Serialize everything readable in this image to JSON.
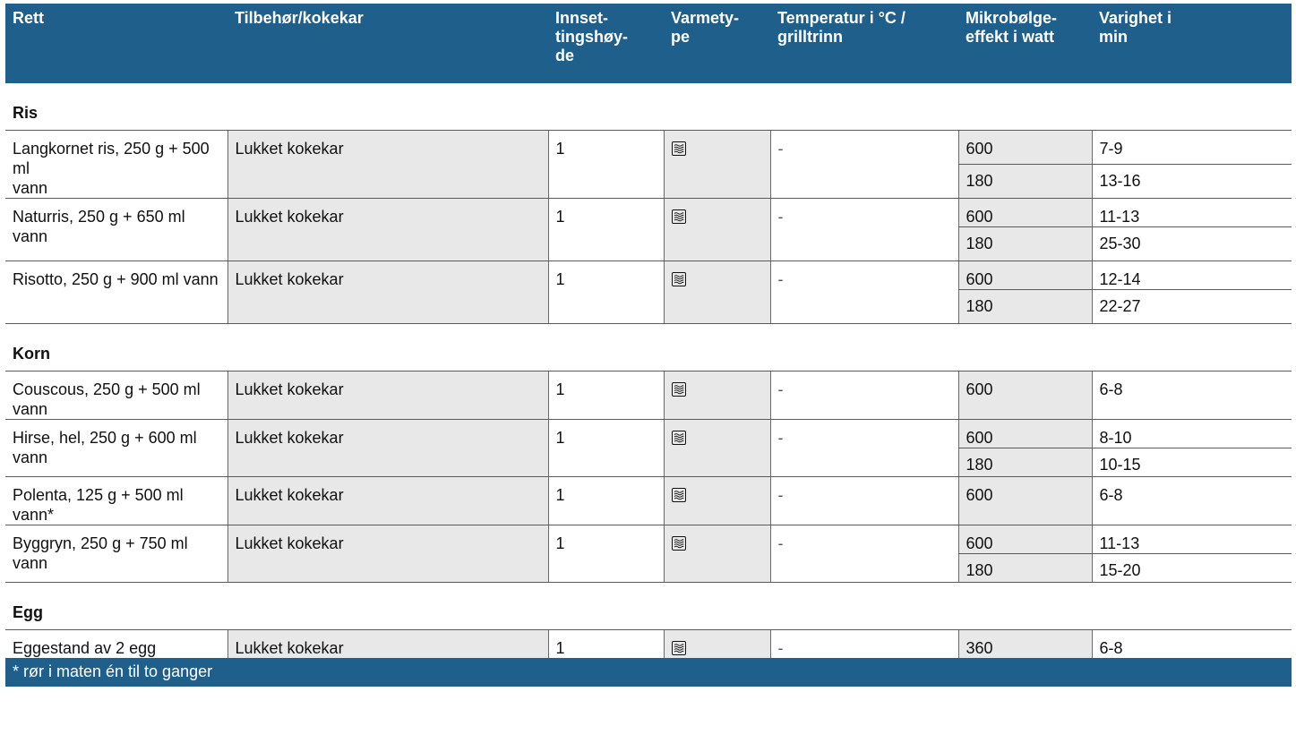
{
  "header": {
    "rett": "Rett",
    "tilbehor": "Tilbehør/kokekar",
    "innsetting_1": "Innset-",
    "innsetting_2": "tingshøy-",
    "innsetting_3": "de",
    "varmetype_1": "Varmety-",
    "varmetype_2": "pe",
    "temperatur_1": "Temperatur i °C /",
    "temperatur_2": "grilltrinn",
    "mikro_1": "Mikrobølge-",
    "mikro_2": "effekt i watt",
    "varighet_1": "Varighet i",
    "varighet_2": "min"
  },
  "groups": {
    "ris": "Ris",
    "korn": "Korn",
    "egg": "Egg"
  },
  "rows": {
    "langkornet": {
      "rett_1": "Langkornet ris, 250 g + 500 ml",
      "rett_2": "vann",
      "tilbehor": "Lukket kokekar",
      "hoyde": "1",
      "temp": "-",
      "effekt_1": "600",
      "tid_1": "7-9",
      "effekt_2": "180",
      "tid_2": "13-16"
    },
    "naturris": {
      "rett": "Naturris, 250 g + 650 ml vann",
      "tilbehor": "Lukket kokekar",
      "hoyde": "1",
      "temp": "-",
      "effekt_1": "600",
      "tid_1": "11-13",
      "effekt_2": "180",
      "tid_2": "25-30"
    },
    "risotto": {
      "rett": "Risotto, 250 g + 900 ml vann",
      "tilbehor": "Lukket kokekar",
      "hoyde": "1",
      "temp": "-",
      "effekt_1": "600",
      "tid_1": "12-14",
      "effekt_2": "180",
      "tid_2": "22-27"
    },
    "couscous": {
      "rett": "Couscous, 250 g + 500 ml vann",
      "tilbehor": "Lukket kokekar",
      "hoyde": "1",
      "temp": "-",
      "effekt_1": "600",
      "tid_1": "6-8"
    },
    "hirse": {
      "rett": "Hirse, hel, 250 g + 600 ml vann",
      "tilbehor": "Lukket kokekar",
      "hoyde": "1",
      "temp": "-",
      "effekt_1": "600",
      "tid_1": "8-10",
      "effekt_2": "180",
      "tid_2": "10-15"
    },
    "polenta": {
      "rett": "Polenta, 125 g + 500 ml vann*",
      "tilbehor": "Lukket kokekar",
      "hoyde": "1",
      "temp": "-",
      "effekt_1": "600",
      "tid_1": "6-8"
    },
    "byggryn": {
      "rett": "Byggryn, 250 g + 750 ml vann",
      "tilbehor": "Lukket kokekar",
      "hoyde": "1",
      "temp": "-",
      "effekt_1": "600",
      "tid_1": "11-13",
      "effekt_2": "180",
      "tid_2": "15-20"
    },
    "eggestand": {
      "rett": "Eggestand av 2 egg",
      "tilbehor": "Lukket kokekar",
      "hoyde": "1",
      "temp": "-",
      "effekt_1": "360",
      "tid_1": "6-8"
    }
  },
  "heat_icon": "microwave-icon",
  "footnote": "* rør i maten én til to ganger"
}
